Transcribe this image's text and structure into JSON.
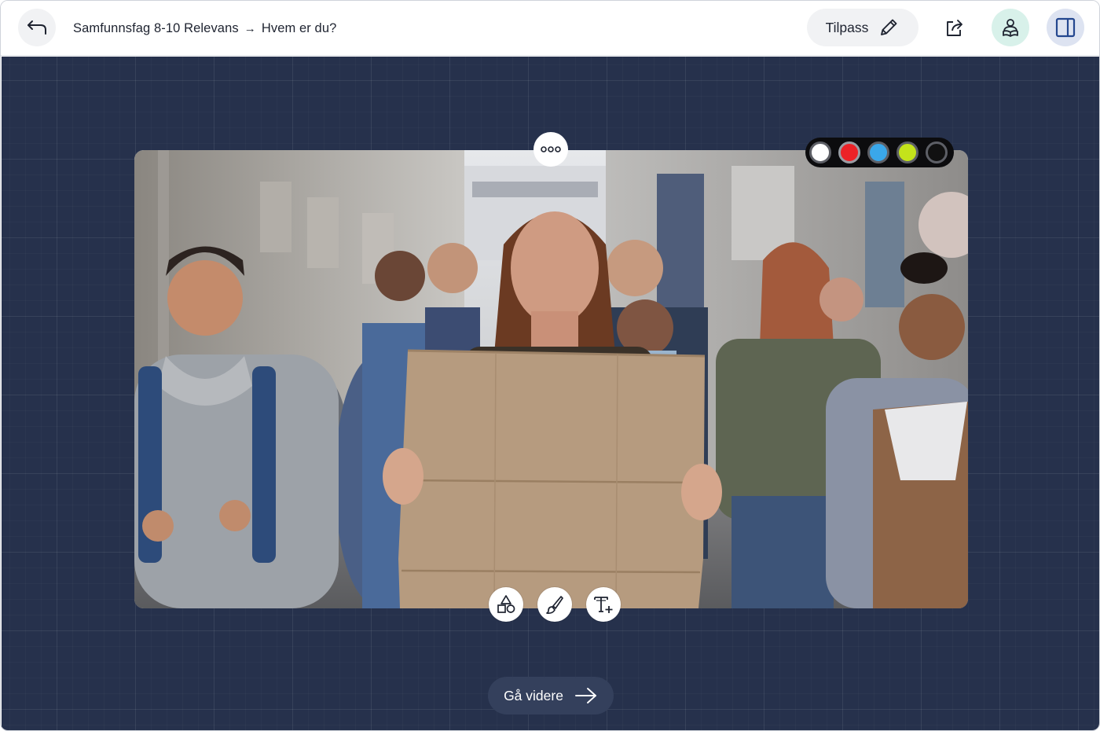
{
  "header": {
    "breadcrumb": {
      "course": "Samfunnsfag 8-10 Relevans",
      "separator": "→",
      "page": "Hvem er du?"
    },
    "customize_label": "Tilpass",
    "icons": {
      "back": "back-arrow-icon",
      "customize": "pencil-icon",
      "share": "share-icon",
      "reader": "reader-icon",
      "panel": "sidebar-panel-icon"
    }
  },
  "image_card": {
    "more_icon": "more-options-icon",
    "palette": {
      "colors": [
        "#ffffff",
        "#ec2227",
        "#3aa7ea",
        "#c4e31b",
        "#111111"
      ],
      "selected_index": 1
    },
    "tools": [
      "shapes-icon",
      "brush-icon",
      "add-text-icon"
    ]
  },
  "footer": {
    "next_label": "Gå videre",
    "next_icon": "arrow-right-icon"
  },
  "theme": {
    "canvas": "#26314c",
    "button_gray": "#f1f2f4",
    "reader_bg": "#d8f1ea",
    "panel_bg": "#dde3f1"
  }
}
